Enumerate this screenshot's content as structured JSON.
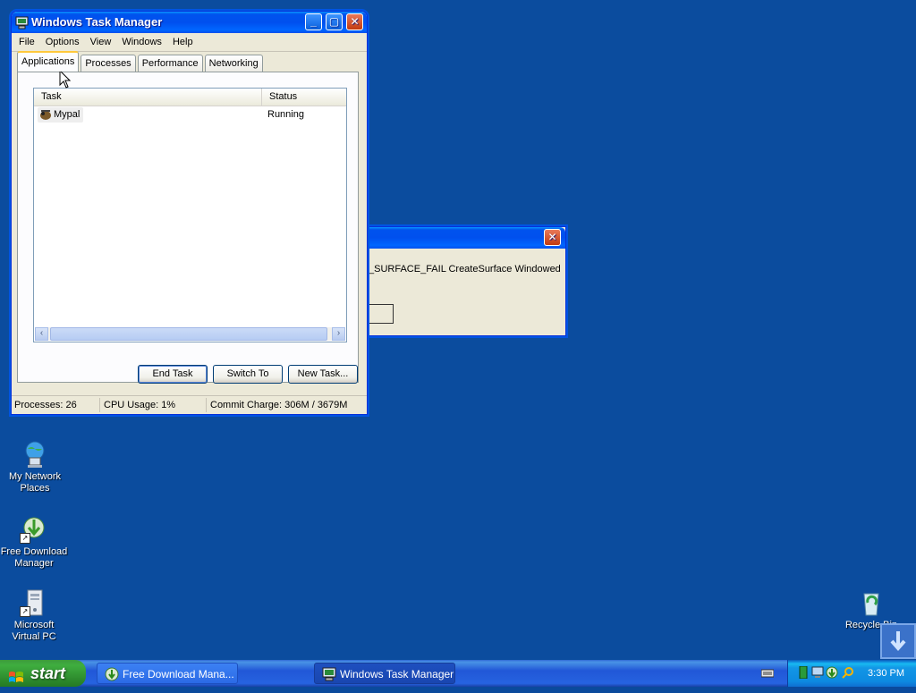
{
  "desktop": {
    "icons": [
      {
        "name": "my-network-places",
        "label_line1": "My Network",
        "label_line2": "Places"
      },
      {
        "name": "free-download-manager",
        "label_line1": "Free Download",
        "label_line2": "Manager"
      },
      {
        "name": "microsoft-virtual-pc",
        "label_line1": "Microsoft",
        "label_line2": "Virtual PC"
      },
      {
        "name": "recycle-bin",
        "label_line1": "Recycle Bin",
        "label_line2": ""
      }
    ]
  },
  "taskmgr": {
    "title": "Windows Task Manager",
    "menu": [
      "File",
      "Options",
      "View",
      "Windows",
      "Help"
    ],
    "tabs": [
      "Applications",
      "Processes",
      "Performance",
      "Networking"
    ],
    "active_tab": "Applications",
    "columns": [
      "Task",
      "Status"
    ],
    "rows": [
      {
        "task": "Mypal",
        "status": "Running"
      }
    ],
    "buttons": {
      "end_task": "End Task",
      "switch_to": "Switch To",
      "new_task": "New Task..."
    },
    "status": {
      "processes": "Processes: 26",
      "cpu": "CPU Usage: 1%",
      "commit": "Commit Charge: 306M / 3679M"
    }
  },
  "error_dialog": {
    "message": "_SURFACE_FAIL CreateSurface Windowed"
  },
  "taskbar": {
    "start_label": "start",
    "items": [
      {
        "label": "Free Download Mana...",
        "active": false
      },
      {
        "label": "Windows Task Manager",
        "active": true
      }
    ],
    "clock": "3:30 PM"
  },
  "colors": {
    "desktop": "#0b4c9e",
    "titlebar": "#0053ee",
    "window": "#ece9d8",
    "start": "#3c9a3c"
  }
}
